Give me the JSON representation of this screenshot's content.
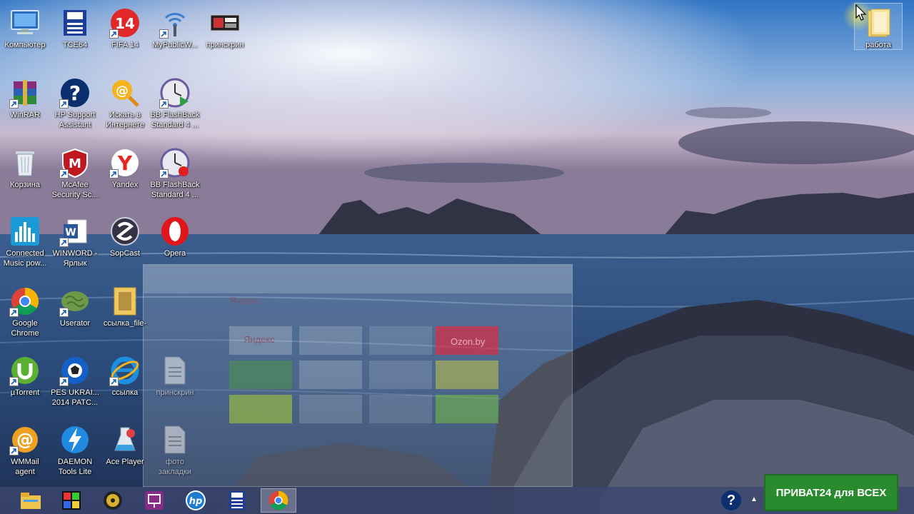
{
  "desktop": {
    "icons": [
      {
        "label": "Компьютер",
        "icon": "computer-icon"
      },
      {
        "label": "TCE64",
        "icon": "document-icon"
      },
      {
        "label": "FIFA 14",
        "icon": "fifa14-icon"
      },
      {
        "label": "MyPublicW...",
        "icon": "wifi-icon"
      },
      {
        "label": "принскрин",
        "icon": "screenshot-icon"
      },
      {
        "label": "WinRAR",
        "icon": "winrar-icon"
      },
      {
        "label": "HP Support\nAssistant",
        "icon": "help-icon"
      },
      {
        "label": "Искать в\nИнтернете",
        "icon": "search-web-icon"
      },
      {
        "label": "BB FlashBack\nStandard 4 ...",
        "icon": "flashback-icon"
      },
      {
        "label": "Корзина",
        "icon": "recycle-bin-icon"
      },
      {
        "label": "McAfee\nSecurity Sc...",
        "icon": "mcafee-icon"
      },
      {
        "label": "Yandex",
        "icon": "yandex-icon"
      },
      {
        "label": "BB FlashBack\nStandard 4 ...",
        "icon": "flashback-recorder-icon"
      },
      {
        "label": "Connected\nMusic pow...",
        "icon": "equalizer-icon"
      },
      {
        "label": "WINWORD -\nЯрлык",
        "icon": "word-icon"
      },
      {
        "label": "SopCast",
        "icon": "sopcast-icon"
      },
      {
        "label": "Opera",
        "icon": "opera-icon"
      },
      {
        "label": "Google\nChrome",
        "icon": "chrome-icon"
      },
      {
        "label": "Userator",
        "icon": "brain-icon"
      },
      {
        "label": "ссылка_file-",
        "icon": "folder-icon"
      },
      {
        "label": "µTorrent",
        "icon": "utorrent-icon"
      },
      {
        "label": "PES UKRAI...\n2014 PATC...",
        "icon": "pes-icon"
      },
      {
        "label": "ссылка",
        "icon": "internet-explorer-icon"
      },
      {
        "label": "принскрин",
        "icon": "document-icon"
      },
      {
        "label": "WMMail\nagent",
        "icon": "wmmail-icon"
      },
      {
        "label": "DAEMON\nTools Lite",
        "icon": "daemon-tools-icon"
      },
      {
        "label": "Ace Player",
        "icon": "ace-player-icon"
      },
      {
        "label": "фото\nзакладки",
        "icon": "document-icon"
      },
      {
        "label": "работа",
        "icon": "folder-icon"
      }
    ]
  },
  "ghost_window": {
    "search_text": "Яндекс",
    "tile_text_1": "Яндекс",
    "tile_text_2": "Ozon.by"
  },
  "taskbar": {
    "items": [
      {
        "icon": "file-explorer-icon"
      },
      {
        "icon": "puzzle-app-icon"
      },
      {
        "icon": "disc-app-icon"
      },
      {
        "icon": "presentation-app-icon"
      },
      {
        "icon": "hp-icon"
      },
      {
        "icon": "document-icon"
      },
      {
        "icon": "chrome-icon"
      }
    ],
    "tray_help": "?",
    "tray_chevron": "▲"
  },
  "banner": {
    "text": "ПРИВАТ24 для ВСЕХ",
    "color": "#2a8a2e"
  }
}
